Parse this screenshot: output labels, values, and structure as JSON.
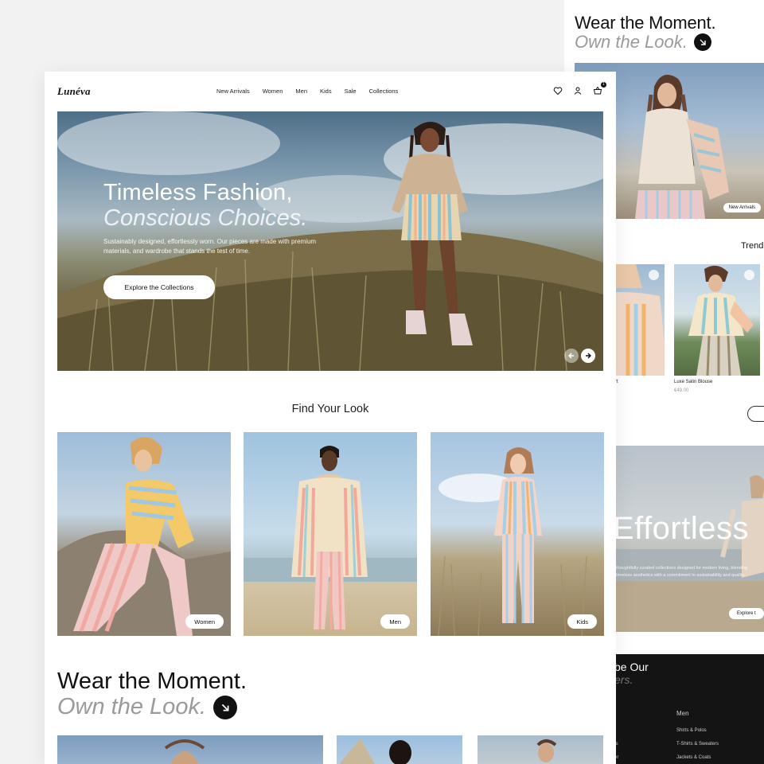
{
  "brand": {
    "logo": "Lunéva"
  },
  "nav": {
    "links": [
      "New Arrivals",
      "Women",
      "Men",
      "Kids",
      "Sale",
      "Collections"
    ],
    "cart_count": "1"
  },
  "hero": {
    "title_line1": "Timeless Fashion,",
    "title_line2": "Conscious Choices.",
    "body": "Sustainably designed, effortlessly worn. Our pieces are made with premium materials, and wardrobe that stands the test of time.",
    "cta": "Explore the Collections"
  },
  "find_look": {
    "title": "Find Your Look",
    "cards": [
      {
        "label": "Women"
      },
      {
        "label": "Men"
      },
      {
        "label": "Kids"
      }
    ]
  },
  "wear": {
    "line1": "Wear the Moment.",
    "line2": "Own the Look."
  },
  "back_page": {
    "heading_line1": "Wear the Moment.",
    "heading_line2": "Own the Look.",
    "hero_badge": "New Arrivals",
    "trending_fragment": "Trend",
    "products": [
      {
        "name": "",
        "price": "",
        "name_fragment": "rt"
      },
      {
        "name": "Luxe Satin Blouse",
        "price": "€49.00"
      }
    ],
    "banner": {
      "word": "Effortless",
      "text": "thoughtfully curated collections designed for modern living, blending timeless aesthetics with a commitment to sustainability and quality.",
      "button_fragment": "Explore t"
    },
    "subscribe": {
      "line1": "be Our",
      "line2": "ers."
    },
    "footer": {
      "column_title": "Men",
      "links": [
        "Shirts & Polos",
        "T-Shirts & Sweaters",
        "Jackets & Coats"
      ],
      "left_fragments": [
        "ts",
        "er"
      ]
    }
  },
  "colors": {
    "ink": "#111111",
    "muted": "#9a9a9a",
    "page_bg": "#f2f2f3",
    "dark_footer": "#141414"
  }
}
